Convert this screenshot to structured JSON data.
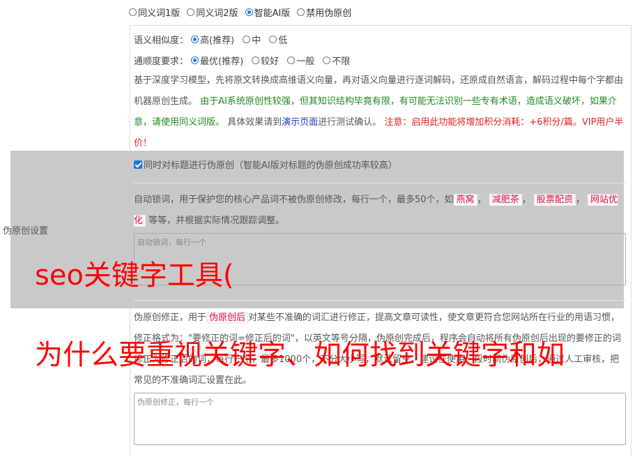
{
  "mode_options": [
    {
      "label": "同义词1版",
      "checked": false
    },
    {
      "label": "同义词2版",
      "checked": false
    },
    {
      "label": "智能AI版",
      "checked": true
    },
    {
      "label": "禁用伪原创",
      "checked": false
    }
  ],
  "similarity": {
    "label": "语义相似度：",
    "options": [
      {
        "label": "高(推荐)",
        "checked": true
      },
      {
        "label": "中",
        "checked": false
      },
      {
        "label": "低",
        "checked": false
      }
    ]
  },
  "fluency": {
    "label": "通顺度要求：",
    "options": [
      {
        "label": "最优(推荐)",
        "checked": true
      },
      {
        "label": "较好",
        "checked": false
      },
      {
        "label": "一般",
        "checked": false
      },
      {
        "label": "不限",
        "checked": false
      }
    ]
  },
  "description": {
    "part1": "基于深度学习模型，先将原文转换成高维语义向量，再对语义向量进行逐词解码，还原成自然语言，解码过程中每个字都由机器原创生成。 ",
    "part2_green": "由于AI系统原创性较强，但其知识结构毕竟有限，有可能无法识别一些专有术语，造成语义破坏，如果介意，请使用同义词版。",
    "part3": " 具体效果请到",
    "part4_link": "演示页面",
    "part5": "进行测试确认。 ",
    "part6_red": "注意：启用此功能将增加积分消耗：+6积分/篇。VIP用户半价！"
  },
  "title_check": {
    "label": "同时对标题进行伪原创（智能AI版对标题的伪原创成功率较高）",
    "checked": true
  },
  "side_label": "伪原创设置",
  "lock": {
    "text_before": "自动锁词，用于保护您的核心产品词不被伪原创修改，每行一个，最多50个，如",
    "tags": [
      "燕窝",
      "减肥茶",
      "股票配资",
      "网站优化"
    ],
    "text_after": "等等，并根据实际情况跟踪调整。",
    "placeholder": "自动锁词，每行一个"
  },
  "fix": {
    "text_before": "伪原创修正，用于",
    "tag": "伪原创后",
    "text_after": "对某些不准确的词汇进行修正，提高文章可读性，使文章更符合您网站所在行业的用语习惯，修正格式为：\"要修正的词=修正后的词\"，以英文等号分隔，伪原创完成后，程序会自动将所有伪原创后出现的要修正的词修正为修正后的词，每行一个，最多1000个，不分大小写，默认留空。建议在使用一段时间伪原创后，通过人工审核，把常见的不准确词汇设置在此。",
    "placeholder": "伪原创修正，每行一个"
  },
  "overlay_title": "seo关键字工具(",
  "overlay_subtitle": "为什么要重视关键字、如何找到关键字和如"
}
